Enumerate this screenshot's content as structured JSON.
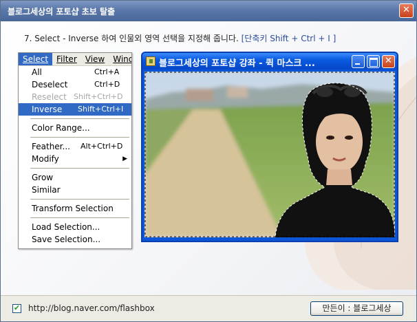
{
  "window": {
    "title": "블로그세상의 포토샵 초보 탈출",
    "close_label": "✕"
  },
  "instruction": {
    "text": "7. Select - Inverse 하여 인물외 영역 선택을 지정해 줍니다.",
    "shortcut": "[단축키 Shift + Ctrl + I ]"
  },
  "menubar": {
    "items": [
      {
        "label": "Select",
        "active": true
      },
      {
        "label": "Filter"
      },
      {
        "label": "View"
      },
      {
        "label": "Wind"
      }
    ]
  },
  "select_menu": {
    "all": {
      "label": "All",
      "shortcut": "Ctrl+A"
    },
    "deselect": {
      "label": "Deselect",
      "shortcut": "Ctrl+D"
    },
    "reselect": {
      "label": "Reselect",
      "shortcut": "Shift+Ctrl+D",
      "disabled": true
    },
    "inverse": {
      "label": "Inverse",
      "shortcut": "Shift+Ctrl+I",
      "highlighted": true
    },
    "color_range": {
      "label": "Color Range..."
    },
    "feather": {
      "label": "Feather...",
      "shortcut": "Alt+Ctrl+D"
    },
    "modify": {
      "label": "Modify",
      "submenu": true
    },
    "grow": {
      "label": "Grow"
    },
    "similar": {
      "label": "Similar"
    },
    "transform_selection": {
      "label": "Transform Selection"
    },
    "load_selection": {
      "label": "Load Selection..."
    },
    "save_selection": {
      "label": "Save Selection..."
    }
  },
  "inner_window": {
    "title": "블로그세상의 포토샵 강좌 - 퀵 마스크 ..."
  },
  "bottom": {
    "checkbox_checked": true,
    "checkbox_mark": "✔",
    "url": "http://blog.naver.com/flashbox",
    "maker_button": "만든이 : 블로그세상"
  },
  "colors": {
    "title_bar": "#5a77a9",
    "menu_highlight": "#316ac5",
    "inner_title_bar": "#0a5be0",
    "shortcut_text": "#2a4c9c"
  }
}
